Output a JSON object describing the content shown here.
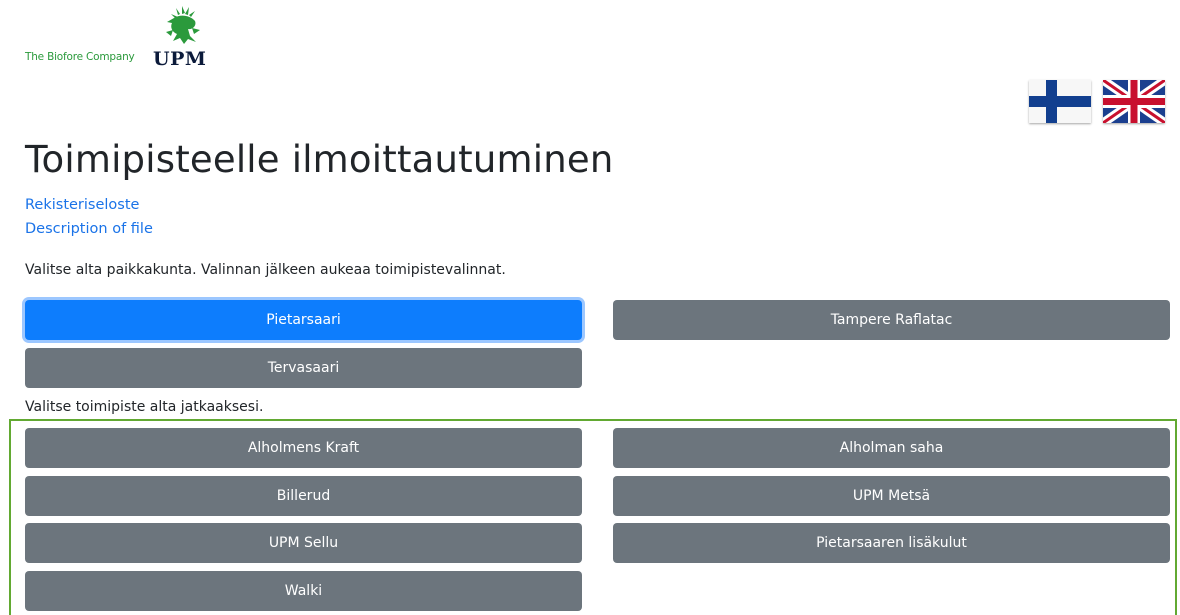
{
  "brand": {
    "tagline": "The Biofore Company",
    "logo_text": "UPM",
    "logo_color": "#2b9a3c"
  },
  "languages": [
    {
      "code": "fi",
      "label": "Finnish flag"
    },
    {
      "code": "en",
      "label": "UK flag"
    }
  ],
  "page": {
    "title": "Toimipisteelle ilmoittautuminen",
    "links": [
      "Rekisteriseloste",
      "Description of file"
    ],
    "city_instruction": "Valitse alta paikkakunta. Valinnan jälkeen aukeaa toimipistevalinnat.",
    "site_instruction": "Valitse toimipiste alta jatkaaksesi."
  },
  "cities": [
    {
      "label": "Pietarsaari",
      "active": true
    },
    {
      "label": "Tampere Raflatac",
      "active": false
    },
    {
      "label": "Tervasaari",
      "active": false
    }
  ],
  "sites": [
    {
      "label": "Alholmens Kraft"
    },
    {
      "label": "Alholman saha"
    },
    {
      "label": "Billerud"
    },
    {
      "label": "UPM Metsä"
    },
    {
      "label": "UPM Sellu"
    },
    {
      "label": "Pietarsaaren lisäkulut"
    },
    {
      "label": "Walki"
    }
  ],
  "colors": {
    "active_button": "#0d7dfd",
    "button": "#6c757d",
    "link": "#1a73e8",
    "highlight_border": "#62a932"
  }
}
